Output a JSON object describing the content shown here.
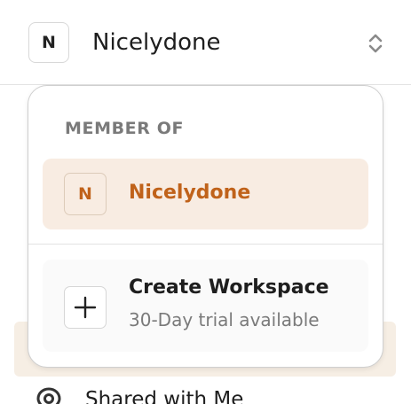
{
  "workspace": {
    "avatar_letter": "N",
    "name": "Nicelydone",
    "switch_icon": "chevron-up-down-icon"
  },
  "dropdown": {
    "section_title": "MEMBER OF",
    "members": [
      {
        "avatar_letter": "N",
        "name": "Nicelydone",
        "selected": true
      }
    ],
    "create": {
      "icon": "plus-icon",
      "title": "Create Workspace",
      "subtitle": "30-Day trial available"
    }
  },
  "sidebar_behind": {
    "item_label": "Shared with Me",
    "item_icon": "location-pin-icon"
  },
  "colors": {
    "accent": "#c0621a",
    "selected_bg": "#f8ece2",
    "muted_text": "#7a7a7a",
    "border": "#d8d8d8"
  }
}
